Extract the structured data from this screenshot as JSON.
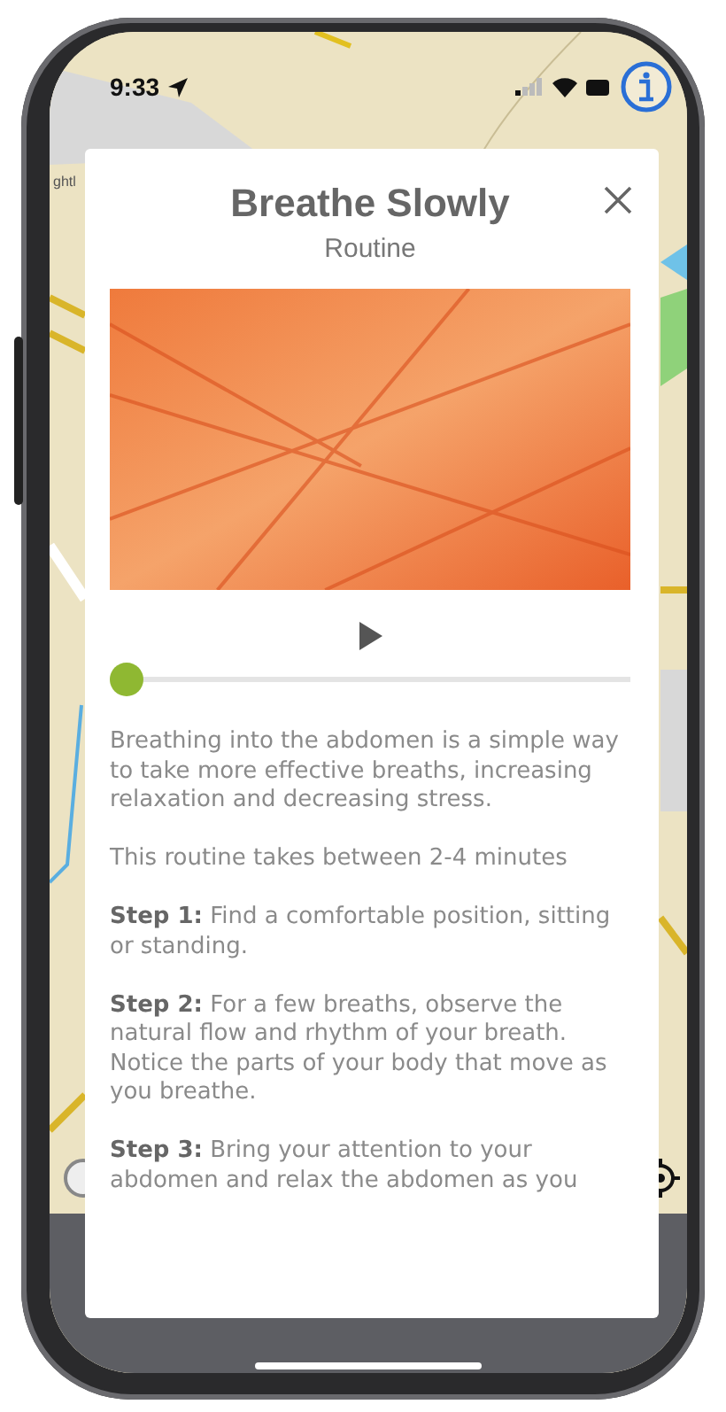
{
  "status_bar": {
    "time": "9:33"
  },
  "map": {
    "label": "ghtl"
  },
  "modal": {
    "title": "Breathe Slowly",
    "subtitle": "Routine",
    "player": {
      "level": 0
    },
    "intro": "Breathing into the abdomen is a simple way to take more effective breaths, increasing relaxation and decreasing stress.",
    "duration": "This routine takes between 2-4 minutes",
    "steps": [
      {
        "text": "**Step 1:** Find a comfortable position, sitting or standing."
      },
      {
        "text": "**Step 2:** For a few breaths, observe the natural flow and rhythm of your breath. Notice the parts of your body that move as you breathe."
      },
      {
        "text": "**Step 3:** Bring your attention to your abdomen and relax the abdomen as you"
      }
    ]
  }
}
